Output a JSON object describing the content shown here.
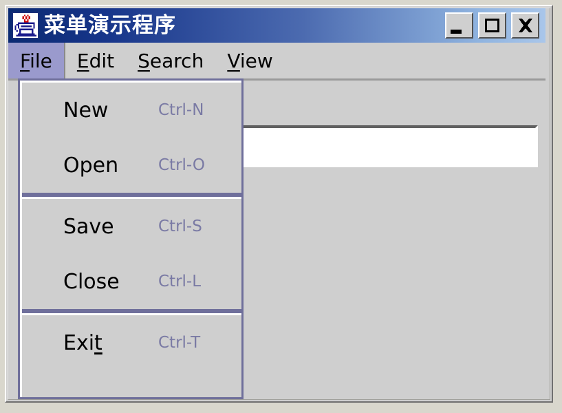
{
  "window": {
    "title": "菜单演示程序",
    "icon": "java-coffee-cup-icon",
    "buttons": {
      "minimize": {
        "name": "minimize-button",
        "glyph": "minimize-icon",
        "label": "_"
      },
      "maximize": {
        "name": "maximize-button",
        "glyph": "maximize-icon",
        "label": "□"
      },
      "close": {
        "name": "close-button",
        "glyph": "close-icon",
        "label": "✕"
      }
    }
  },
  "menubar": {
    "items": [
      {
        "label": "File",
        "mnemonic": "F",
        "selected": true
      },
      {
        "label": "Edit",
        "mnemonic": "E",
        "selected": false
      },
      {
        "label": "Search",
        "mnemonic": "S",
        "selected": false
      },
      {
        "label": "View",
        "mnemonic": "V",
        "selected": false
      }
    ]
  },
  "popup_menu": {
    "owner": "File",
    "groups": [
      {
        "items": [
          {
            "label": "New",
            "accelerator": "Ctrl-N",
            "mnemonic": ""
          },
          {
            "label": "Open",
            "accelerator": "Ctrl-O",
            "mnemonic": ""
          }
        ]
      },
      {
        "items": [
          {
            "label": "Save",
            "accelerator": "Ctrl-S",
            "mnemonic": ""
          },
          {
            "label": "Close",
            "accelerator": "Ctrl-L",
            "mnemonic": ""
          }
        ]
      },
      {
        "items": [
          {
            "label": "Exit",
            "accelerator": "Ctrl-T",
            "mnemonic": "t"
          }
        ]
      }
    ]
  },
  "content": {
    "textfield": {
      "value": "",
      "placeholder": ""
    }
  },
  "colors": {
    "title_gradient_start": "#0a2a72",
    "title_gradient_end": "#a9c6ea",
    "face": "#cfcfcf",
    "menu_highlight": "#9a9acd",
    "accelerator_text": "#7a7aa4",
    "popup_border": "#6f6f9b",
    "desktop": "#d9d7cd"
  }
}
